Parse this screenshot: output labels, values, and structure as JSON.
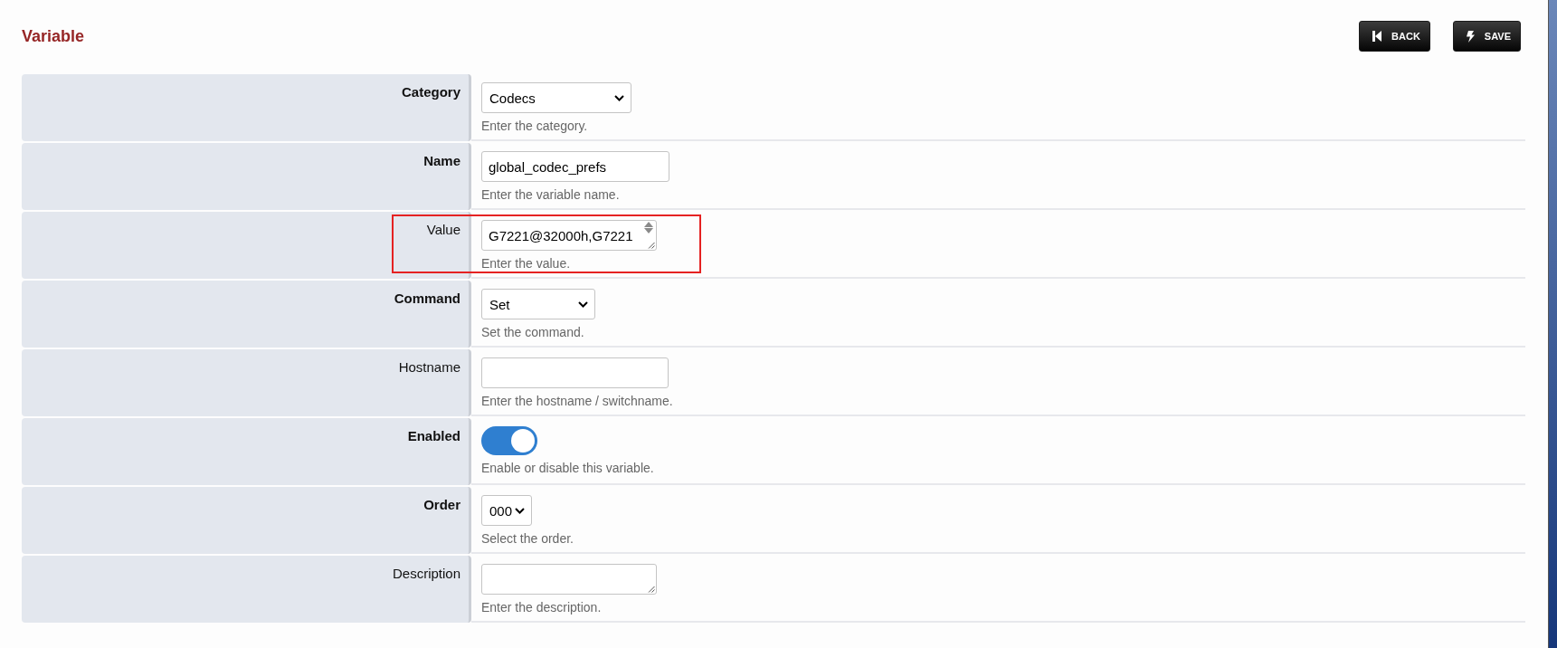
{
  "page": {
    "title": "Variable"
  },
  "buttons": [
    {
      "kind": "back",
      "label": "BACK"
    },
    {
      "kind": "save",
      "label": "SAVE"
    }
  ],
  "fields": [
    {
      "label": "Category",
      "required": true,
      "highlighted": false,
      "kind": "select",
      "value": "Codecs",
      "help": "Enter the category."
    },
    {
      "label": "Name",
      "required": true,
      "highlighted": false,
      "kind": "input",
      "value": "global_codec_prefs",
      "help": "Enter the variable name."
    },
    {
      "label": "Value",
      "required": false,
      "highlighted": true,
      "kind": "textarea",
      "scrollbar": true,
      "value": "G7221@32000h,G7221",
      "help": "Enter the value."
    },
    {
      "label": "Command",
      "required": true,
      "highlighted": false,
      "kind": "select",
      "value": "Set",
      "help": "Set the command."
    },
    {
      "label": "Hostname",
      "required": false,
      "highlighted": false,
      "kind": "input",
      "help": "Enter the hostname / switchname."
    },
    {
      "label": "Enabled",
      "required": true,
      "highlighted": false,
      "kind": "toggle",
      "on": true,
      "help": "Enable or disable this variable."
    },
    {
      "label": "Order",
      "required": true,
      "highlighted": false,
      "kind": "select",
      "value": "000",
      "help": "Select the order."
    },
    {
      "label": "Description",
      "required": false,
      "highlighted": false,
      "kind": "textarea",
      "scrollbar": false,
      "help": "Enter the description."
    }
  ]
}
